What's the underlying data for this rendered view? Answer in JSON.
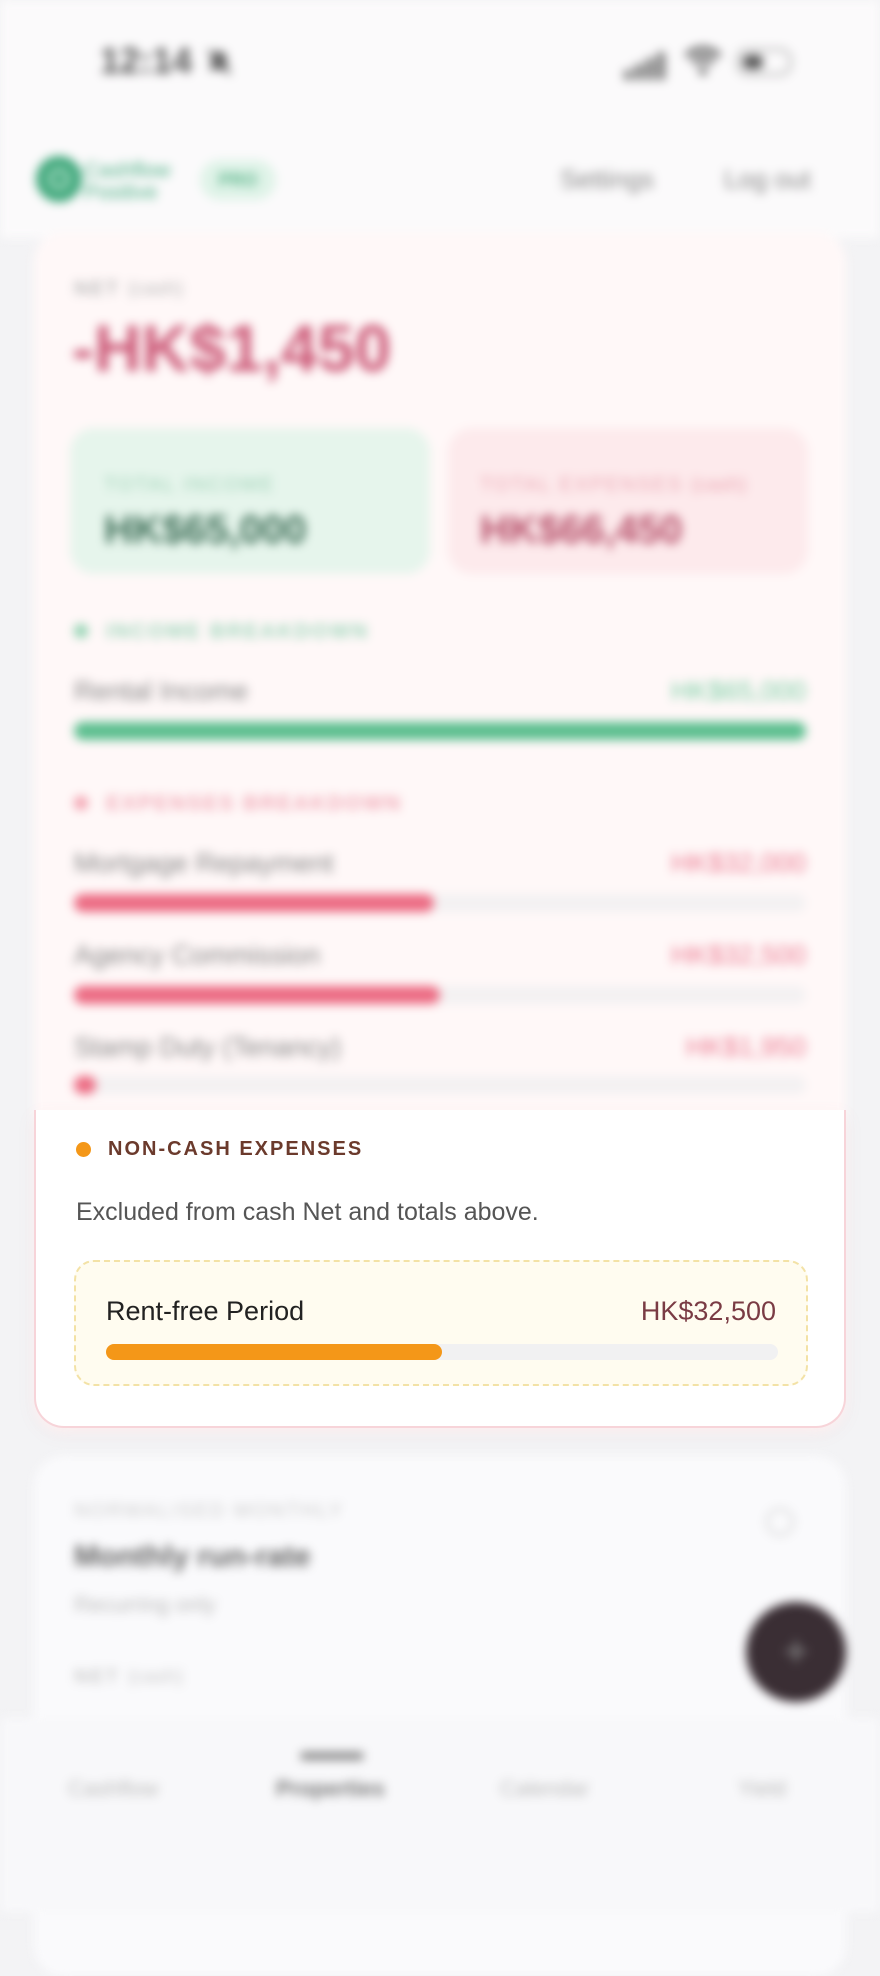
{
  "status_bar": {
    "time": "12:14",
    "icons": [
      "bell-slash-icon",
      "signal-icon",
      "wifi-icon",
      "battery-icon"
    ]
  },
  "header": {
    "brand_line1": "Cashflow",
    "brand_line2": "Positive",
    "badge": "PRO",
    "settings": "Settings",
    "logout": "Log out"
  },
  "summary": {
    "net_label": "NET",
    "net_sub": "(cash)",
    "net_value": "-HK$1,450",
    "total_income_label": "TOTAL INCOME",
    "total_income_value": "HK$65,000",
    "total_expenses_label": "TOTAL EXPENSES",
    "total_expenses_sub": "(cash)",
    "total_expenses_value": "HK$66,450"
  },
  "income_breakdown": {
    "title": "INCOME BREAKDOWN",
    "items": [
      {
        "name": "Rental Income",
        "value": "HK$65,000",
        "fraction": 1.0
      }
    ]
  },
  "expenses_breakdown": {
    "title": "EXPENSES BREAKDOWN",
    "items": [
      {
        "name": "Mortgage Repayment",
        "value": "HK$32,000",
        "fraction": 0.492
      },
      {
        "name": "Agency Commission",
        "value": "HK$32,500",
        "fraction": 0.5
      },
      {
        "name": "Stamp Duty (Tenancy)",
        "value": "HK$1,950",
        "fraction": 0.03
      }
    ]
  },
  "non_cash": {
    "title": "NON-CASH EXPENSES",
    "description": "Excluded from cash Net and totals above.",
    "items": [
      {
        "name": "Rent-free Period",
        "value": "HK$32,500",
        "fraction": 0.5
      }
    ]
  },
  "normalised": {
    "eyebrow": "NORMALISED MONTHLY",
    "title": "Monthly run-rate",
    "subtitle": "Recurring only",
    "net_label": "NET",
    "net_sub": "(cash)"
  },
  "tabs": [
    {
      "label": "Cashflow"
    },
    {
      "label": "Properties",
      "active": true
    },
    {
      "label": "Calendar"
    },
    {
      "label": "Yield"
    }
  ],
  "colors": {
    "income": "#5cbf8f",
    "expense": "#ec6b83",
    "non_cash": "#f49718",
    "title_brown": "#6b3a2c",
    "noncash_value": "#7a3b44"
  }
}
